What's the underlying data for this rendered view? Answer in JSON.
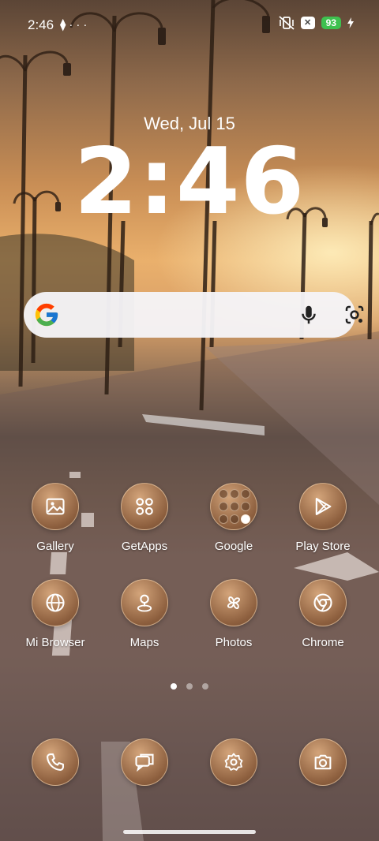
{
  "status_bar": {
    "time": "2:46",
    "left_icons": [
      "navigation-icon",
      "more-dots-icon"
    ],
    "right_icons": [
      "mute-vibrate-icon",
      "x-icon",
      "charging-icon"
    ],
    "battery_level": "93"
  },
  "lock": {
    "date": "Wed, Jul 15",
    "time": "2:46"
  },
  "search_bar": {
    "icons": [
      "google-logo-icon",
      "microphone-icon",
      "google-lens-icon"
    ]
  },
  "apps": [
    {
      "label": "Gallery",
      "icon": "gallery-icon"
    },
    {
      "label": "GetApps",
      "icon": "getapps-icon"
    },
    {
      "label": "Google",
      "icon": "folder-icon"
    },
    {
      "label": "Play Store",
      "icon": "play-store-icon"
    },
    {
      "label": "Mi Browser",
      "icon": "globe-icon"
    },
    {
      "label": "Maps",
      "icon": "maps-pin-icon"
    },
    {
      "label": "Photos",
      "icon": "pinwheel-icon"
    },
    {
      "label": "Chrome",
      "icon": "chrome-icon"
    }
  ],
  "page_indicator": {
    "pages": 3,
    "active": 1
  },
  "dock": [
    {
      "icon": "phone-icon"
    },
    {
      "icon": "messages-icon"
    },
    {
      "icon": "settings-gear-icon"
    },
    {
      "icon": "camera-icon"
    }
  ],
  "colors": {
    "icon_bg": "#8d5f3e",
    "battery": "#3ec04f",
    "search_bg": "#f5f4f7"
  }
}
